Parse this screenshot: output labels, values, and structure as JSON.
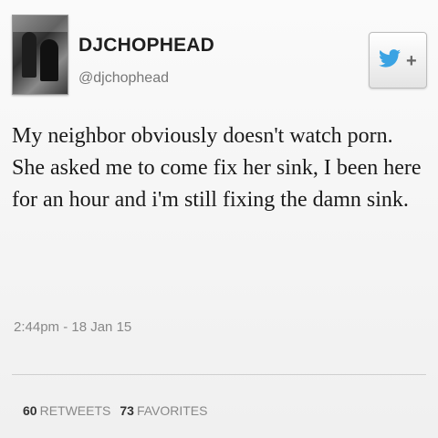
{
  "profile": {
    "display_name": "DJCHOPHEAD",
    "handle": "@djchophead"
  },
  "follow_button": {
    "icon": "twitter-bird-plus-icon",
    "label": "+"
  },
  "tweet": {
    "text": "My neighbor obviously doesn't watch porn. She asked me to come fix her sink, I been here for an hour and i'm still fixing the damn sink.",
    "timestamp": "2:44pm - 18 Jan 15"
  },
  "stats": {
    "retweets_count": "60",
    "retweets_label": "RETWEETS",
    "favorites_count": "73",
    "favorites_label": "FAVORITES"
  },
  "colors": {
    "twitter_blue": "#3aa3e3",
    "background": "#f2f2f2"
  }
}
